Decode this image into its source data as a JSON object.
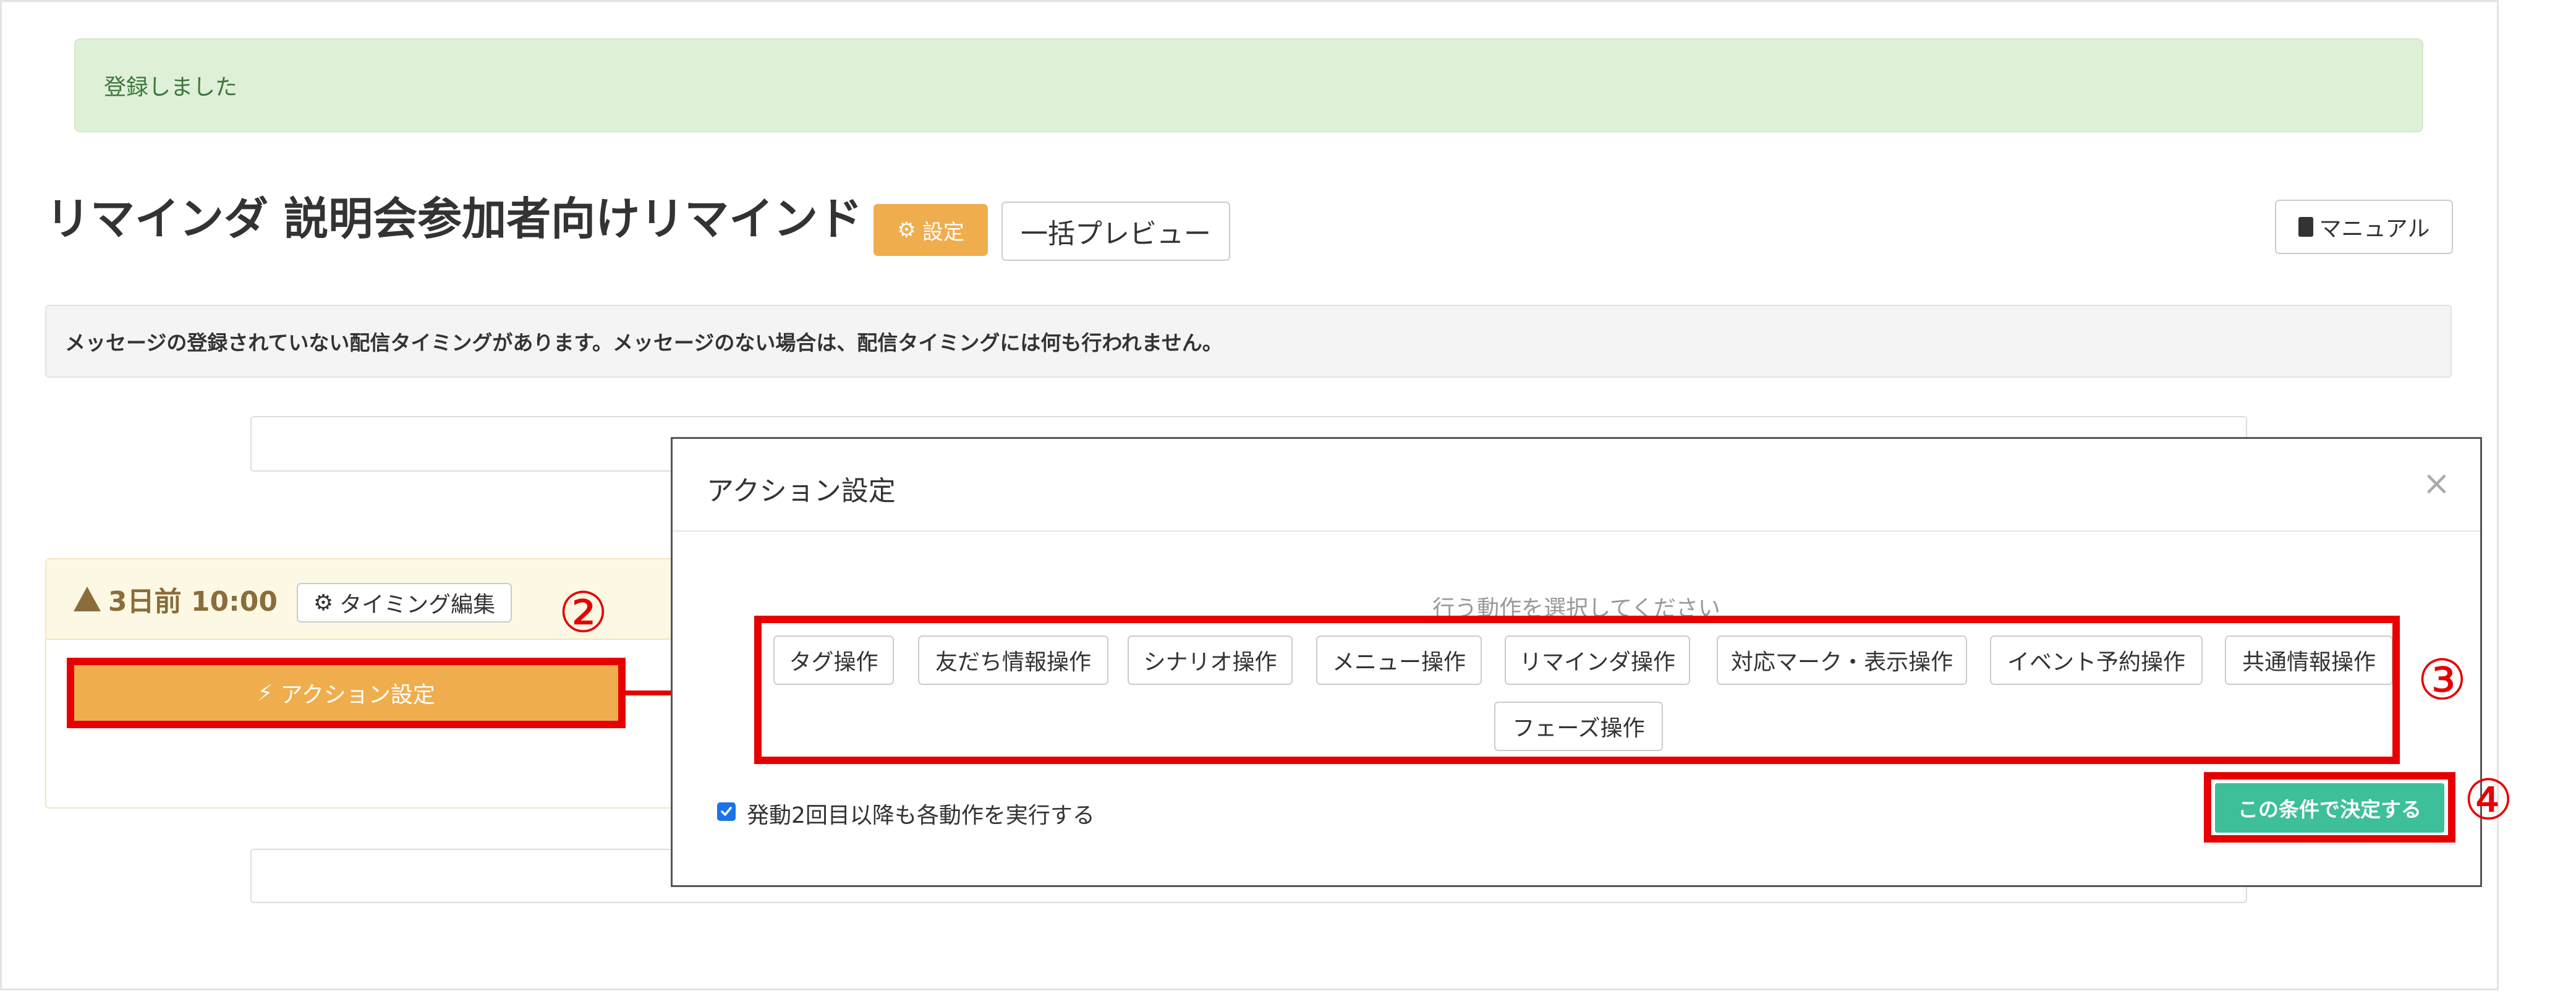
{
  "alert": {
    "message": "登録しました"
  },
  "header": {
    "title": "リマインダ 説明会参加者向けリマインド",
    "settings_label": "設定",
    "preview_label": "一括プレビュー",
    "manual_label": "マニュアル"
  },
  "warning": {
    "message": "メッセージの登録されていない配信タイミングがあります。メッセージのない場合は、配信タイミングには何も行われません。"
  },
  "timing": {
    "label": "3日前 10:00",
    "edit_label": "タイミング編集",
    "action_label": "アクション設定"
  },
  "modal": {
    "title": "アクション設定",
    "close": "×",
    "prompt": "行う動作を選択してください",
    "operations": [
      "タグ操作",
      "友だち情報操作",
      "シナリオ操作",
      "メニュー操作",
      "リマインダ操作",
      "対応マーク・表示操作",
      "イベント予約操作",
      "共通情報操作",
      "フェーズ操作"
    ],
    "checkbox_label": "発動2回目以降も各動作を実行する",
    "checkbox_checked": true,
    "submit_label": "この条件で決定する"
  },
  "annotations": {
    "step2": "②",
    "step3": "③",
    "step4": "④"
  },
  "colors": {
    "accent_orange": "#f0ad4e",
    "annotation_red": "#e60000",
    "submit_green": "#3dbf9a",
    "alert_green": "#dff0d8"
  }
}
